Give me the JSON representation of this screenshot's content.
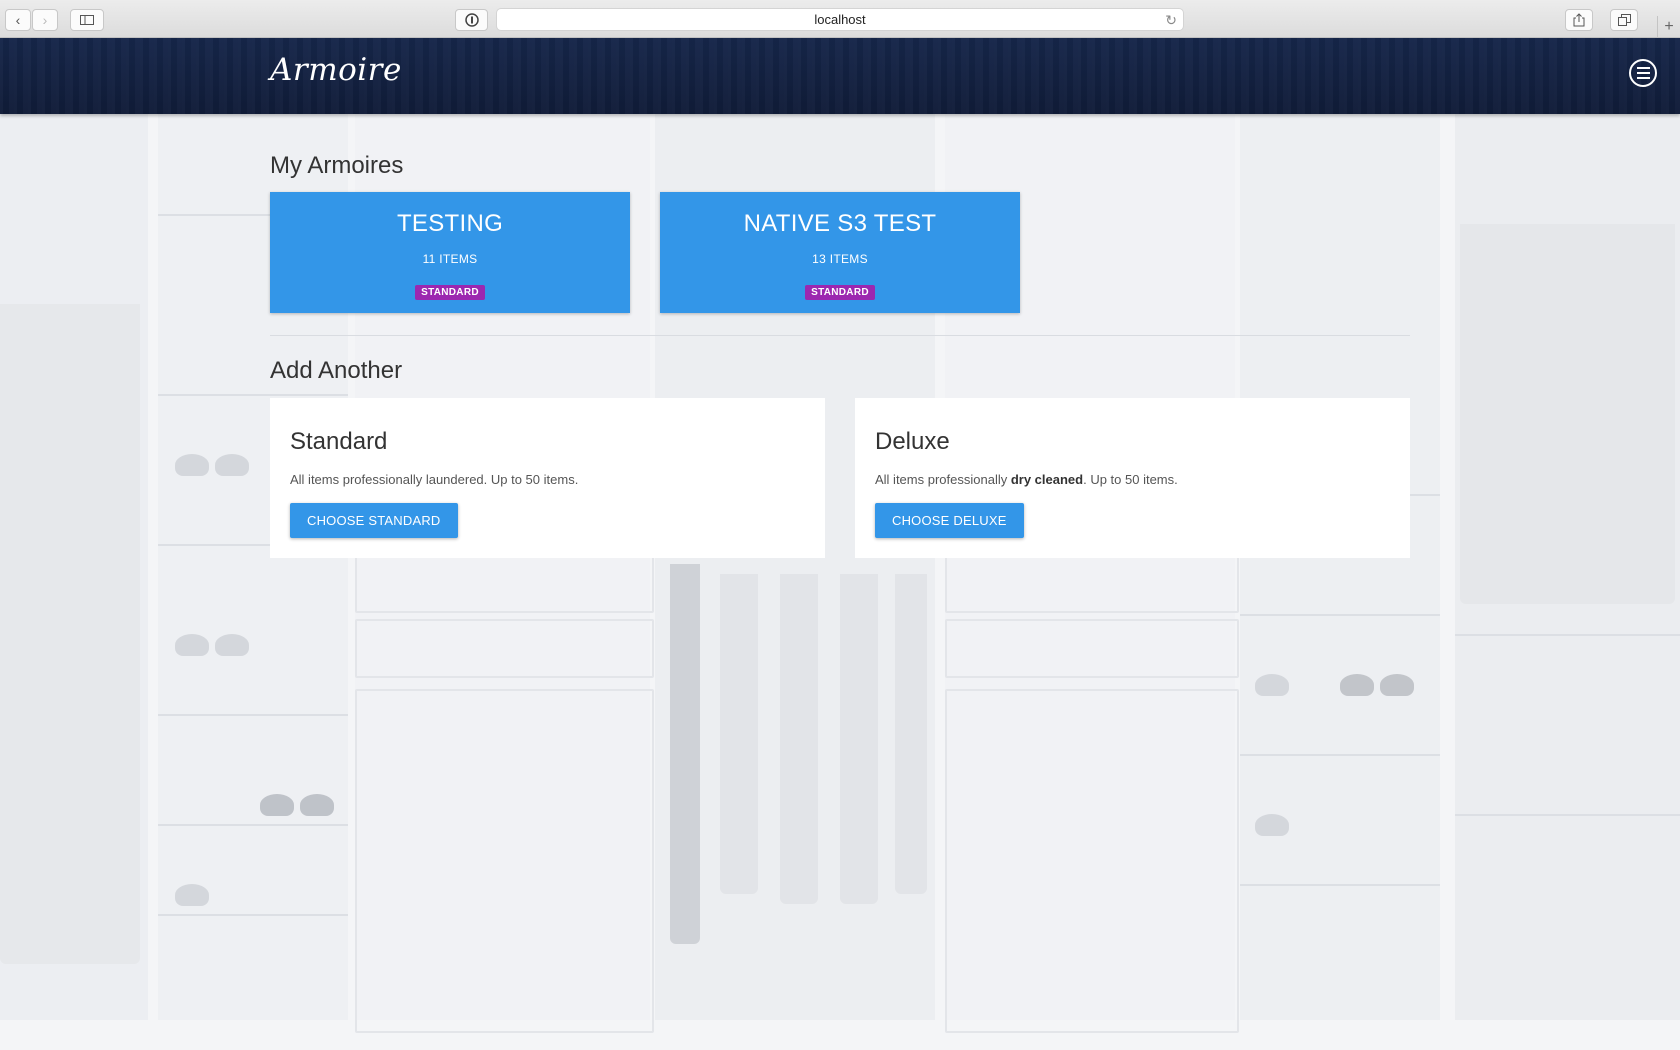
{
  "browser": {
    "url": "localhost"
  },
  "header": {
    "logo": "Armoire"
  },
  "my_armoires": {
    "title": "My Armoires",
    "cards": [
      {
        "name": "TESTING",
        "count": "11 ITEMS",
        "badge": "STANDARD"
      },
      {
        "name": "NATIVE S3 TEST",
        "count": "13 ITEMS",
        "badge": "STANDARD"
      }
    ]
  },
  "add_another": {
    "title": "Add Another",
    "plans": [
      {
        "name": "Standard",
        "desc_prefix": "All items professionally laundered. Up to 50 items.",
        "desc_bold": "",
        "desc_suffix": "",
        "button": "CHOOSE STANDARD"
      },
      {
        "name": "Deluxe",
        "desc_prefix": "All items professionally ",
        "desc_bold": "dry cleaned",
        "desc_suffix": ". Up to 50 items.",
        "button": "CHOOSE DELUXE"
      }
    ]
  },
  "colors": {
    "header_navy": "#13223f",
    "card_blue": "#3396e8",
    "badge_purple": "#9c27b0"
  }
}
